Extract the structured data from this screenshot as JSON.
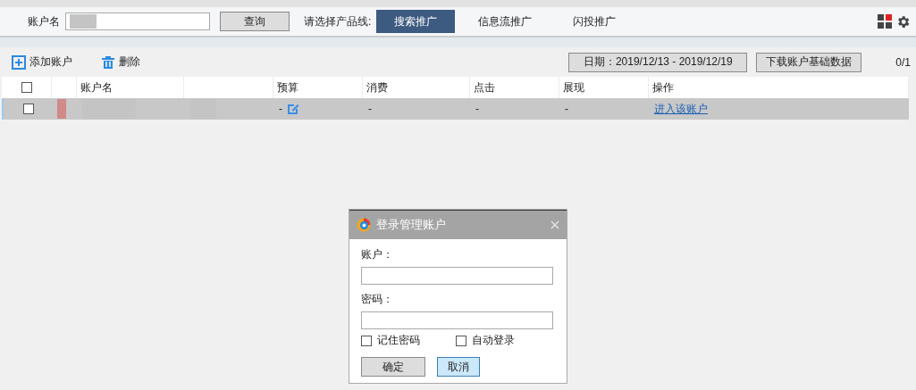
{
  "search": {
    "label": "账户名",
    "button": "查询"
  },
  "product_line": {
    "label": "请选择产品线:",
    "tabs": [
      {
        "label": "搜索推广",
        "selected": true
      },
      {
        "label": "信息流推广",
        "selected": false
      },
      {
        "label": "闪投推广",
        "selected": false
      }
    ]
  },
  "toolbar": {
    "add": "添加账户",
    "delete": "删除",
    "date_button": "日期：2019/12/13 - 2019/12/19",
    "download_button": "下载账户基础数据",
    "pager": "0/1"
  },
  "table": {
    "select_all_checked": false,
    "columns": [
      "账户名",
      "预算",
      "消费",
      "点击",
      "展现",
      "操作"
    ],
    "rows": [
      {
        "checked": false,
        "selected": true,
        "budget": "-",
        "spend": "-",
        "clicks": "-",
        "impressions": "-",
        "action": "进入该账户"
      }
    ]
  },
  "dialog": {
    "title": "登录管理账户",
    "fields": [
      {
        "label": "账户："
      },
      {
        "label": "密码："
      }
    ],
    "options": [
      {
        "label": "记住密码",
        "checked": false
      },
      {
        "label": "自动登录",
        "checked": false
      }
    ],
    "buttons": [
      {
        "label": "确定",
        "kind": "default"
      },
      {
        "label": "取消",
        "kind": "focused"
      }
    ]
  }
}
